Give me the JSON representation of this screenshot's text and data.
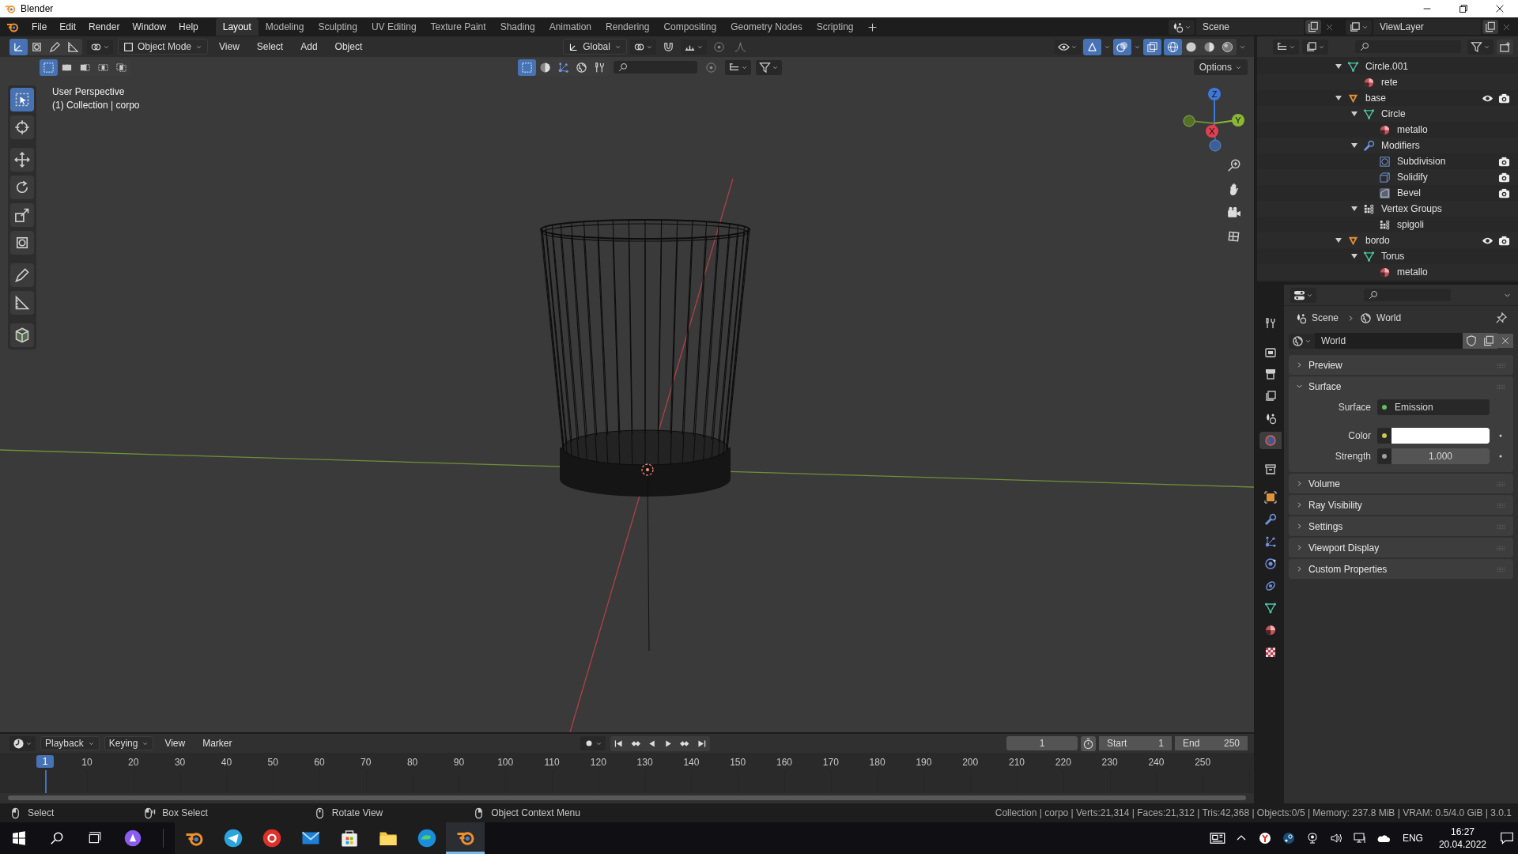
{
  "window": {
    "title": "Blender"
  },
  "menu": [
    "File",
    "Edit",
    "Render",
    "Window",
    "Help"
  ],
  "workspaces": [
    {
      "label": "Layout",
      "selected": true
    },
    {
      "label": "Modeling",
      "selected": false
    },
    {
      "label": "Sculpting",
      "selected": false
    },
    {
      "label": "UV Editing",
      "selected": false
    },
    {
      "label": "Texture Paint",
      "selected": false
    },
    {
      "label": "Shading",
      "selected": false
    },
    {
      "label": "Animation",
      "selected": false
    },
    {
      "label": "Rendering",
      "selected": false
    },
    {
      "label": "Compositing",
      "selected": false
    },
    {
      "label": "Geometry Nodes",
      "selected": false
    },
    {
      "label": "Scripting",
      "selected": false
    }
  ],
  "scene": "Scene",
  "view_layer": "ViewLayer",
  "viewport": {
    "mode": "Object Mode",
    "menus": [
      "View",
      "Select",
      "Add",
      "Object"
    ],
    "orientation": "Global",
    "options": "Options",
    "overlay_text": [
      "User Perspective",
      "(1) Collection | corpo"
    ],
    "axes": [
      "Z",
      "X",
      "Y"
    ],
    "select_modes": [
      {
        "selected": true
      },
      {
        "selected": false
      },
      {
        "selected": false
      },
      {
        "selected": false
      },
      {
        "selected": false
      }
    ],
    "shading": [
      {
        "kind": "wireframe",
        "selected": true
      },
      {
        "kind": "solid",
        "selected": false
      },
      {
        "kind": "material",
        "selected": false
      },
      {
        "kind": "rendered",
        "selected": false
      }
    ],
    "tools": [
      {
        "kind": "select",
        "selected": true
      },
      {
        "kind": "cursor",
        "selected": false
      },
      {
        "kind": "move",
        "selected": false
      },
      {
        "kind": "rotate",
        "selected": false
      },
      {
        "kind": "scale",
        "selected": false
      },
      {
        "kind": "transform",
        "selected": false
      },
      {
        "kind": "annotate",
        "selected": false
      },
      {
        "kind": "measure",
        "selected": false
      },
      {
        "kind": "add-cube",
        "selected": false
      }
    ]
  },
  "outliner": {
    "tree": [
      {
        "name": "Circle.001",
        "kind": "mesh",
        "expanded": true,
        "children": [
          {
            "name": "rete",
            "kind": "material"
          }
        ]
      },
      {
        "name": "base",
        "kind": "object",
        "expanded": true,
        "children": [
          {
            "name": "Circle",
            "kind": "mesh",
            "expanded": true,
            "children": [
              {
                "name": "metallo",
                "kind": "material"
              }
            ]
          },
          {
            "name": "Modifiers",
            "kind": "modifiers",
            "expanded": true,
            "children": [
              {
                "name": "Subdivision",
                "kind": "subdivision"
              },
              {
                "name": "Solidify",
                "kind": "solidify"
              },
              {
                "name": "Bevel",
                "kind": "bevel"
              }
            ]
          },
          {
            "name": "Vertex Groups",
            "kind": "vertex-groups",
            "expanded": true,
            "children": [
              {
                "name": "spigoli",
                "kind": "vertex-group"
              }
            ]
          }
        ]
      },
      {
        "name": "bordo",
        "kind": "object",
        "expanded": true,
        "children": [
          {
            "name": "Torus",
            "kind": "mesh",
            "expanded": true,
            "children": [
              {
                "name": "metallo",
                "kind": "material"
              }
            ]
          }
        ]
      }
    ]
  },
  "properties": {
    "tabs": [
      {
        "kind": "tool",
        "selected": false
      },
      {
        "kind": "render",
        "selected": false
      },
      {
        "kind": "output",
        "selected": false
      },
      {
        "kind": "view-layer",
        "selected": false
      },
      {
        "kind": "scene",
        "selected": false
      },
      {
        "kind": "world",
        "selected": true
      },
      {
        "kind": "collection",
        "selected": false
      },
      {
        "kind": "object",
        "selected": false
      },
      {
        "kind": "modifiers",
        "selected": false
      },
      {
        "kind": "particles",
        "selected": false
      },
      {
        "kind": "physics",
        "selected": false
      },
      {
        "kind": "constraints",
        "selected": false
      },
      {
        "kind": "data",
        "selected": false
      },
      {
        "kind": "material",
        "selected": false
      },
      {
        "kind": "texture",
        "selected": false
      }
    ],
    "breadcrumb": [
      "Scene",
      "World"
    ],
    "datablock": "World",
    "panels": [
      {
        "label": "Preview",
        "expanded": false
      },
      {
        "label": "Surface",
        "expanded": true,
        "fields": [
          {
            "label": "Surface",
            "kind": "shader",
            "value": "Emission"
          },
          {
            "label": "Color",
            "kind": "color",
            "color": "#ffffff"
          },
          {
            "label": "Strength",
            "kind": "number",
            "value": "1.000"
          }
        ]
      },
      {
        "label": "Volume",
        "expanded": false
      },
      {
        "label": "Ray Visibility",
        "expanded": false
      },
      {
        "label": "Settings",
        "expanded": false
      },
      {
        "label": "Viewport Display",
        "expanded": false
      },
      {
        "label": "Custom Properties",
        "expanded": false
      }
    ]
  },
  "timeline": {
    "menus": [
      "Playback",
      "Keying",
      "View",
      "Marker"
    ],
    "frame": "1",
    "start_label": "Start",
    "start": "1",
    "end_label": "End",
    "end": "250",
    "playhead": "1",
    "ticks": [
      "10",
      "20",
      "30",
      "40",
      "50",
      "60",
      "70",
      "80",
      "90",
      "100",
      "110",
      "120",
      "130",
      "140",
      "150",
      "160",
      "170",
      "180",
      "190",
      "200",
      "210",
      "220",
      "230",
      "240",
      "250"
    ]
  },
  "status_bar": {
    "hints": [
      {
        "label": "Select",
        "kind": "left"
      },
      {
        "label": "Box Select",
        "kind": "left-drag"
      },
      {
        "label": "Rotate View",
        "kind": "middle"
      },
      {
        "label": "Object Context Menu",
        "kind": "right"
      }
    ],
    "stats": "Collection | corpo | Verts:21,314 | Faces:21,312 | Tris:42,368 | Objects:0/5 | Memory: 237.8 MiB | VRAM: 0.5/4.0 GiB | 3.0.1"
  },
  "taskbar": {
    "apps": [
      {
        "kind": "blender",
        "selected": false
      },
      {
        "kind": "telegram",
        "selected": false
      },
      {
        "kind": "yandex",
        "selected": false
      },
      {
        "kind": "mail",
        "selected": false
      },
      {
        "kind": "store",
        "selected": false
      },
      {
        "kind": "explorer",
        "selected": false
      },
      {
        "kind": "edge",
        "selected": false
      },
      {
        "kind": "blender",
        "selected": true
      }
    ],
    "language": "ENG",
    "time": "16:27",
    "date": "20.04.2022"
  }
}
